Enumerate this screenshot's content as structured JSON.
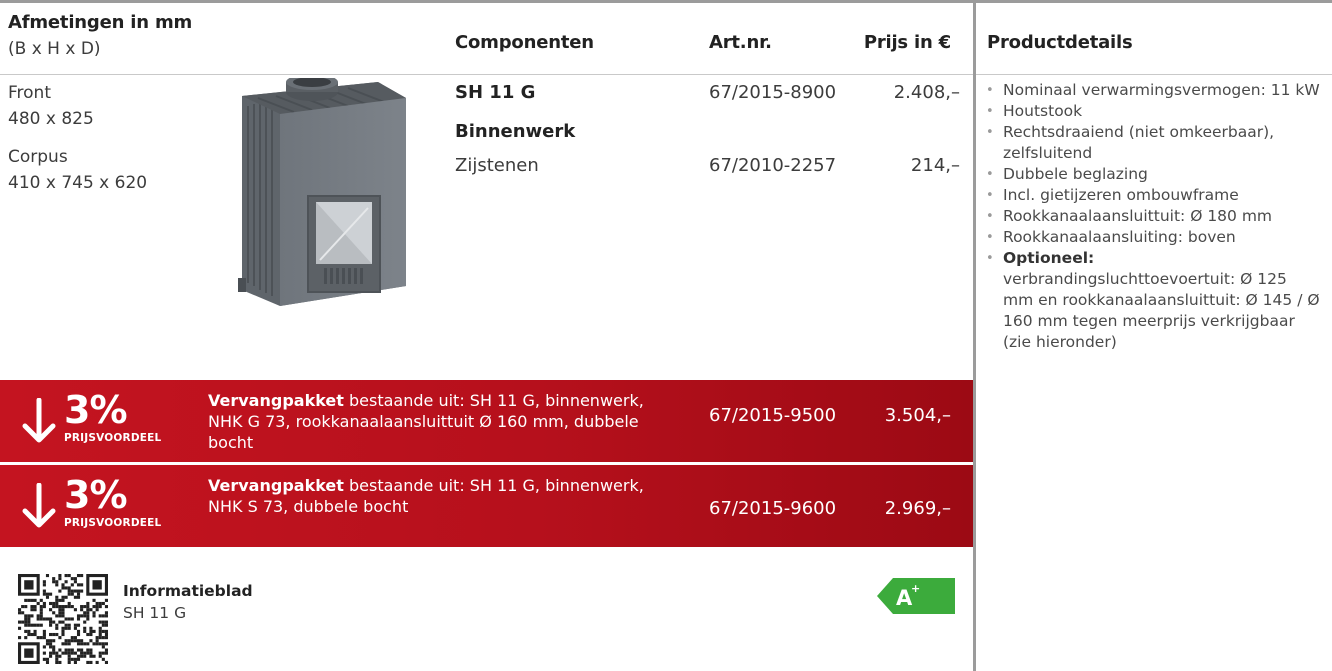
{
  "header": {
    "dimensions_title": "Afmetingen in mm",
    "dimensions_sub": "(B x H x D)",
    "components": "Componenten",
    "artnr": "Art.nr.",
    "price": "Prijs in €",
    "details": "Productdetails"
  },
  "dimensions": {
    "front_label": "Front",
    "front_value": "480 x 825",
    "corpus_label": "Corpus",
    "corpus_value": "410 x 745 x 620"
  },
  "components": {
    "main_name": "SH 11 G",
    "main_artnr": "67/2015-8900",
    "main_price": "2.408,–",
    "section_label": "Binnenwerk",
    "sub_name": "Zijstenen",
    "sub_artnr": "67/2010-2257",
    "sub_price": "214,–"
  },
  "packages": [
    {
      "percent": "3%",
      "badge": "PRIJSVOORDEEL",
      "title": "Vervangpakket",
      "description": " bestaande uit: SH 11 G, binnenwerk, NHK G 73, rookkanaalaansluittuit Ø 160 mm, dubbele bocht",
      "artnr": "67/2015-9500",
      "price": "3.504,–"
    },
    {
      "percent": "3%",
      "badge": "PRIJSVOORDEEL",
      "title": "Vervangpakket",
      "description": " bestaande uit: SH 11 G, binnenwerk, NHK S 73, dubbele bocht",
      "artnr": "67/2015-9600",
      "price": "2.969,–"
    }
  ],
  "info": {
    "title": "Informatieblad",
    "subtitle": "SH 11 G"
  },
  "energy_label": {
    "class": "A",
    "sup": "+",
    "color": "#3cab3c"
  },
  "details": {
    "items": [
      "Nominaal verwarmingsvermogen: 11 kW",
      "Houtstook",
      "Rechtsdraaiend (niet omkeerbaar), zelfsluitend",
      "Dubbele beglazing",
      "Incl. gietijzeren ombouwframe",
      "Rookkanaalaansluittuit: Ø 180 mm",
      "Rookkanaalaansluiting: boven"
    ],
    "optional_label": "Optioneel:",
    "optional_text": "verbrandingsluchttoevoertuit: Ø 125 mm en rookkanaalaansluittuit: Ø 145 / Ø 160 mm tegen meerprijs verkrijgbaar (zie hieronder)"
  },
  "colors": {
    "band_red": "#c41420",
    "rule_gray": "#9b9b9b",
    "energy_green": "#3cab3c"
  }
}
